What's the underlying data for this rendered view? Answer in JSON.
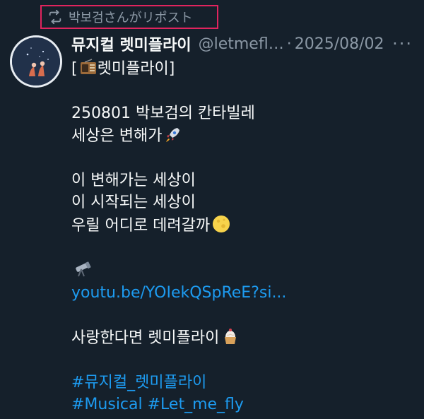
{
  "repost": {
    "label": "박보검さんがリポスト",
    "icon": "repost-icon"
  },
  "author": {
    "display_name": "뮤지컬 렛미플라이",
    "handle": "@letmefl…",
    "separator": "·",
    "date": "2025/08/02",
    "avatar_icon": "avatar"
  },
  "more_label": "···",
  "post": {
    "line1_text": "[",
    "line1_text_end": "렛미플라이]",
    "line1_emoji": "radio-emoji",
    "line2": "250801 박보검의 칸타빌레",
    "line3_text": "세상은 변해가",
    "line3_emoji": "rocket-emoji",
    "line4": "이 변해가는 세상이",
    "line5": "이 시작되는 세상이",
    "line6_text": "우릴 어디로 데려갈까",
    "line6_emoji": "full-moon-emoji",
    "line7_emoji": "telescope-emoji",
    "link": "youtu.be/YOIekQSpReE?si...",
    "line8_text": "사랑한다면 렛미플라이",
    "line8_emoji": "cupcake-emoji",
    "hashtag1": "#뮤지컬_렛미플라이",
    "hashtag2": "#Musical #Let_me_fly"
  },
  "colors": {
    "background": "#15202b",
    "text": "#f7f9f9",
    "muted": "#8b98a5",
    "link": "#1d9bf0",
    "highlight_box": "#e0245e"
  }
}
